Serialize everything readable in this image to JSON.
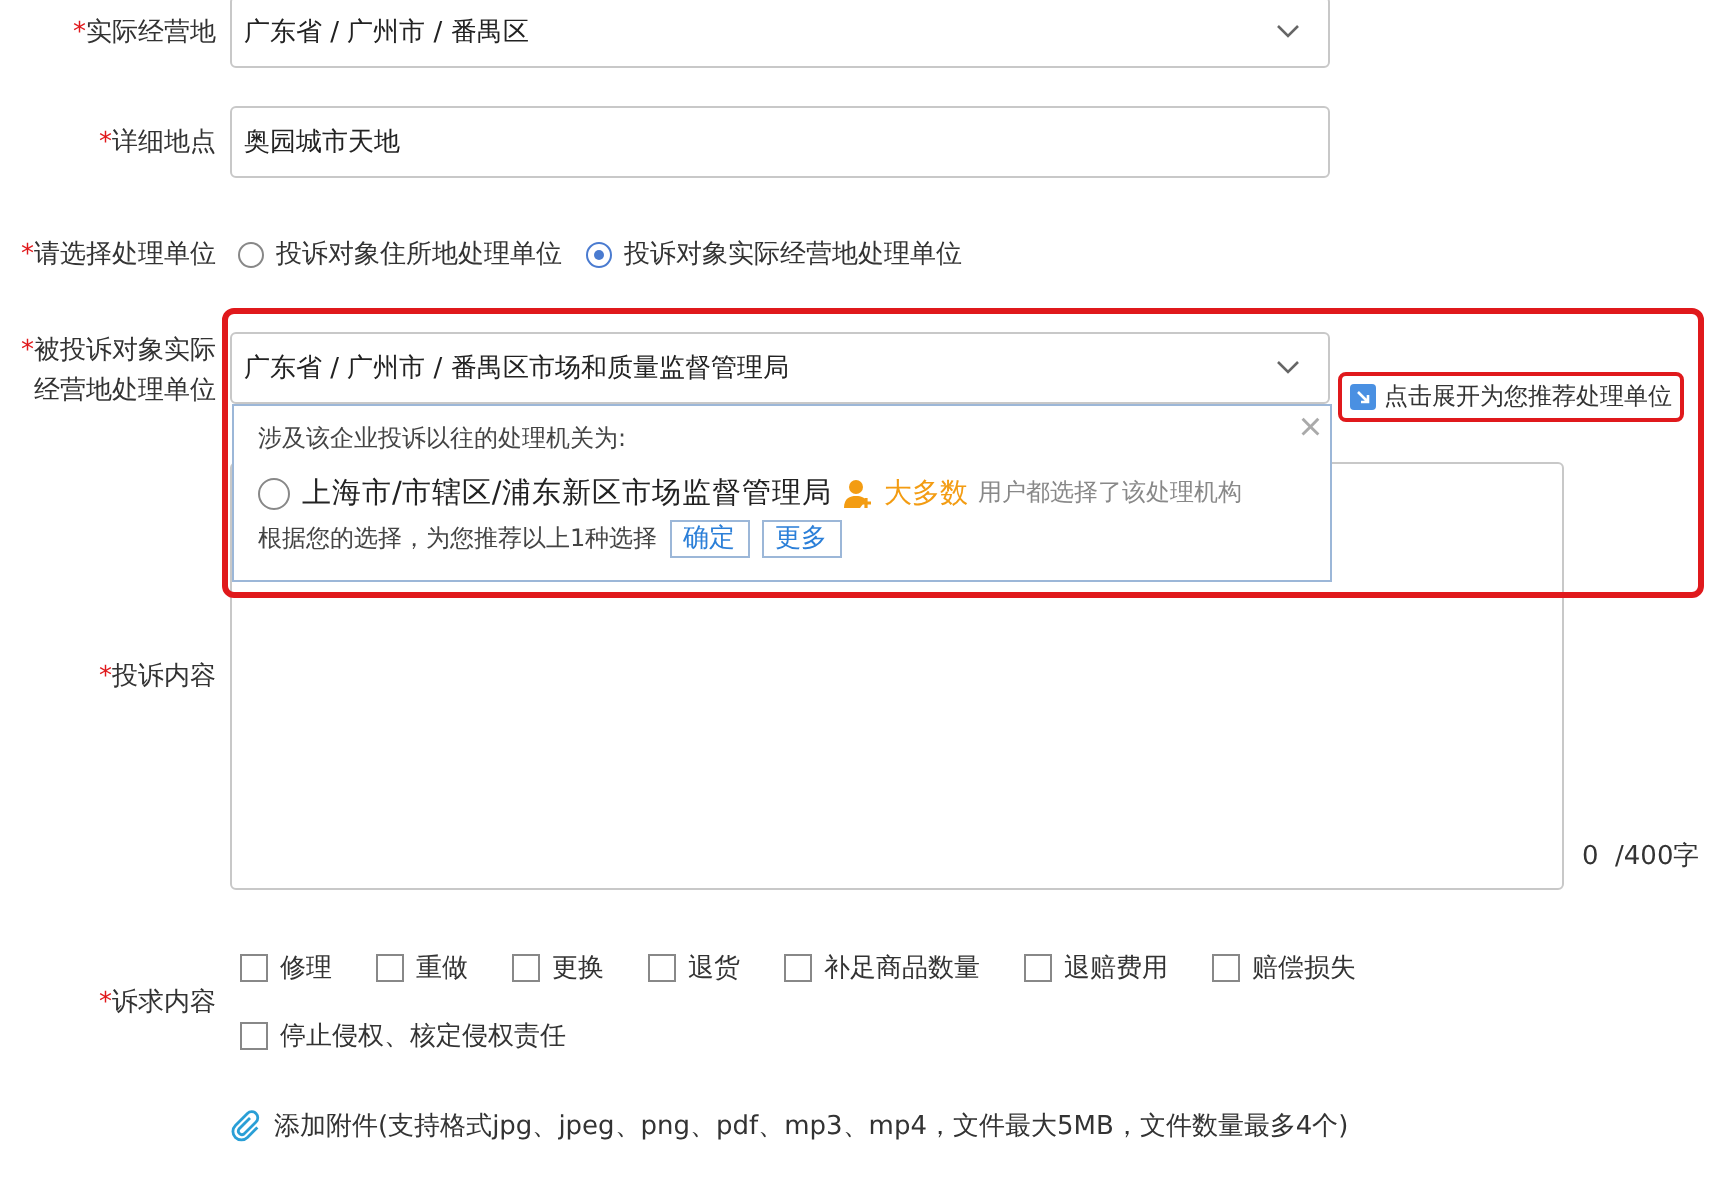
{
  "business_location": {
    "label": "实际经营地",
    "mark": "*",
    "value": "广东省 / 广州市 / 番禺区"
  },
  "detail_address": {
    "label": "详细地点",
    "mark": "*",
    "value": "奥园城市天地"
  },
  "handler_choice": {
    "label": "请选择处理单位",
    "mark": "*",
    "options": [
      {
        "label": "投诉对象住所地处理单位",
        "selected": false
      },
      {
        "label": "投诉对象实际经营地处理单位",
        "selected": true
      }
    ]
  },
  "handler_unit": {
    "label_lines": [
      "被投诉对象实际",
      "经营地处理单位"
    ],
    "mark": "*",
    "value": "广东省 / 广州市 / 番禺区市场和质量监督管理局",
    "recommend_link": "点击展开为您推荐处理单位",
    "highlighted": true
  },
  "recommendation_popup": {
    "intro": "涉及该企业投诉以往的处理机关为:",
    "close": "×",
    "option": {
      "label": "上海市/市辖区/浦东新区市场监督管理局",
      "selected": false
    },
    "badge": "大多数",
    "badge_note": "用户都选择了该处理机构",
    "summary": "根据您的选择，为您推荐以上1种选择",
    "buttons": [
      "确定",
      "更多"
    ]
  },
  "complaint_content": {
    "label": "投诉内容",
    "mark": "*",
    "counter": "0",
    "limit": "/400字"
  },
  "demands": {
    "label": "诉求内容",
    "mark": "*",
    "options": [
      {
        "label": "修理",
        "checked": false
      },
      {
        "label": "重做",
        "checked": false
      },
      {
        "label": "更换",
        "checked": false
      },
      {
        "label": "退货",
        "checked": false
      },
      {
        "label": "补足商品数量",
        "checked": false
      },
      {
        "label": "退赔费用",
        "checked": false
      },
      {
        "label": "赔偿损失",
        "checked": false
      },
      {
        "label": "停止侵权、核定侵权责任",
        "checked": false
      }
    ]
  },
  "attachment": {
    "label": "添加附件(支持格式jpg、jpeg、png、pdf、mp3、mp4，文件最大5MB，文件数量最多4个)"
  }
}
